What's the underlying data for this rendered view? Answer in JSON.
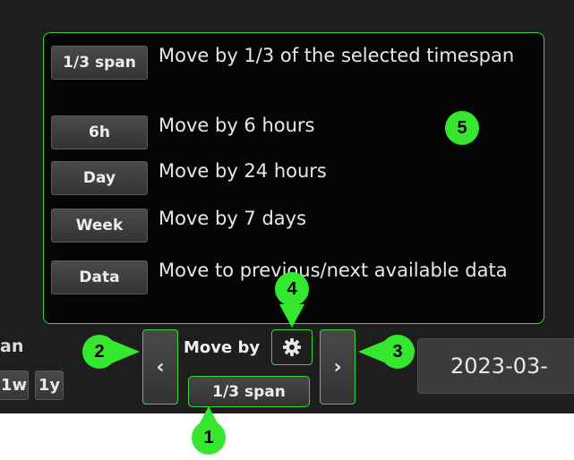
{
  "popup": {
    "options": [
      {
        "button": "1/3 span",
        "description": "Move by 1/3 of the selected timespan"
      },
      {
        "button": "6h",
        "description": "Move by 6 hours"
      },
      {
        "button": "Day",
        "description": "Move by 24 hours"
      },
      {
        "button": "Week",
        "description": "Move by 7 days"
      },
      {
        "button": "Data",
        "description": "Move to previous/next available data"
      }
    ]
  },
  "bar": {
    "left_label_partial": "an",
    "quick_buttons": [
      "1w",
      "1y"
    ],
    "prev_icon": "chevron-left-icon",
    "prev_glyph": "‹",
    "next_icon": "chevron-right-icon",
    "next_glyph": "›",
    "move_by_label": "Move by",
    "gear_icon": "gear-icon",
    "span_value": "1/3 span",
    "date_text": "2023-03-"
  },
  "callouts": [
    "1",
    "2",
    "3",
    "4",
    "5"
  ],
  "colors": {
    "highlight": "#39d53a",
    "callout_fill": "#35e82f",
    "background": "#1e1e1e",
    "popup_background": "#050505"
  }
}
